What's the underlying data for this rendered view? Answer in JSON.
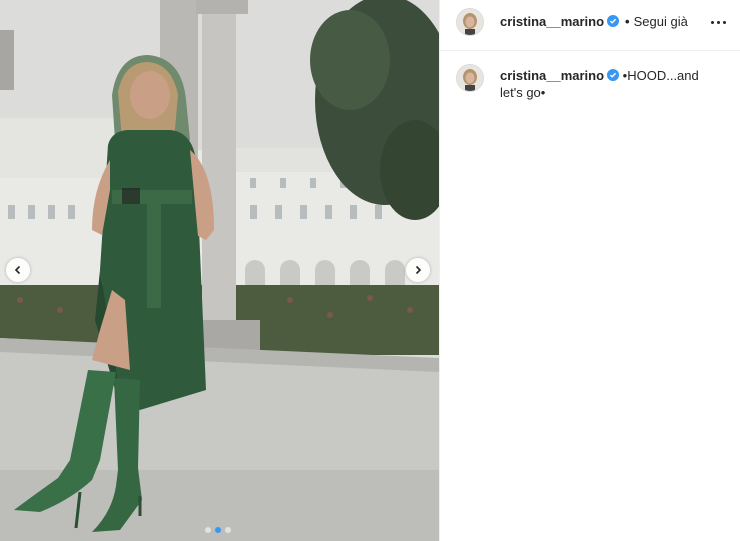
{
  "post": {
    "author": {
      "username": "cristina__marino",
      "verified": true,
      "follow_status": "Segui già"
    },
    "caption": "•HOOD...and let's go•",
    "carousel": {
      "slide_count": 3,
      "active_index": 1
    }
  },
  "icons": {
    "verified": "verified-badge-icon",
    "more": "more-options-icon",
    "prev": "chevron-left-icon",
    "next": "chevron-right-icon"
  },
  "colors": {
    "verified_blue": "#3897f0",
    "dress_green": "#2f5a3c"
  }
}
